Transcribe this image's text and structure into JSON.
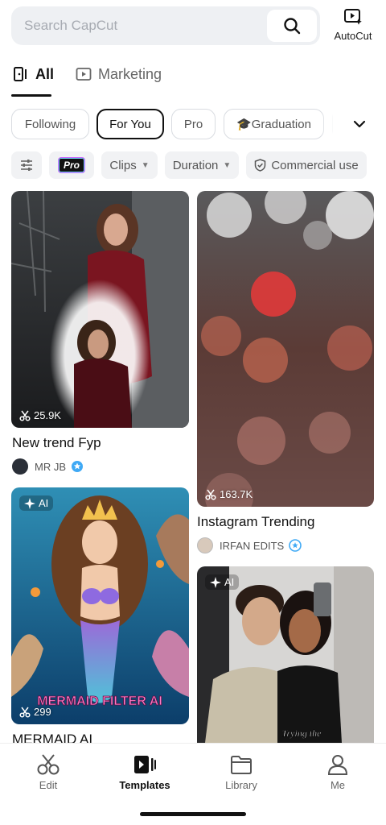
{
  "search": {
    "placeholder": "Search CapCut"
  },
  "header": {
    "autocut_label": "AutoCut"
  },
  "tabs": [
    {
      "label": "All",
      "active": true
    },
    {
      "label": "Marketing",
      "active": false
    }
  ],
  "categories": [
    {
      "label": "Following",
      "active": false
    },
    {
      "label": "For You",
      "active": true
    },
    {
      "label": "Pro",
      "active": false
    },
    {
      "label": "🎓Graduation",
      "active": false
    }
  ],
  "filters": {
    "pro_badge": "Pro",
    "clips": "Clips",
    "duration": "Duration",
    "commercial": "Commercial use"
  },
  "cards": [
    {
      "title": "New trend Fyp",
      "uses": "25.9K",
      "author": "MR JB",
      "ai": false
    },
    {
      "title": "Instagram Trending",
      "uses": "163.7K",
      "author": "IRFAN EDITS",
      "ai": false
    },
    {
      "title": "MERMAID AI",
      "uses": "299",
      "author": "",
      "ai": true,
      "ai_label": "AI",
      "overlay_text": "MERMAID FILTER AI"
    },
    {
      "title": "",
      "uses": "",
      "author": "",
      "ai": true,
      "ai_label": "AI",
      "overlay_text": "Trying the"
    }
  ],
  "bottom_nav": [
    {
      "label": "Edit",
      "icon": "scissors-icon",
      "active": false
    },
    {
      "label": "Templates",
      "icon": "templates-icon",
      "active": true
    },
    {
      "label": "Library",
      "icon": "folder-icon",
      "active": false
    },
    {
      "label": "Me",
      "icon": "user-icon",
      "active": false
    }
  ],
  "colors": {
    "accent": "#111111",
    "verified": "#3fa9f5",
    "chip_border": "#d9dce1"
  }
}
